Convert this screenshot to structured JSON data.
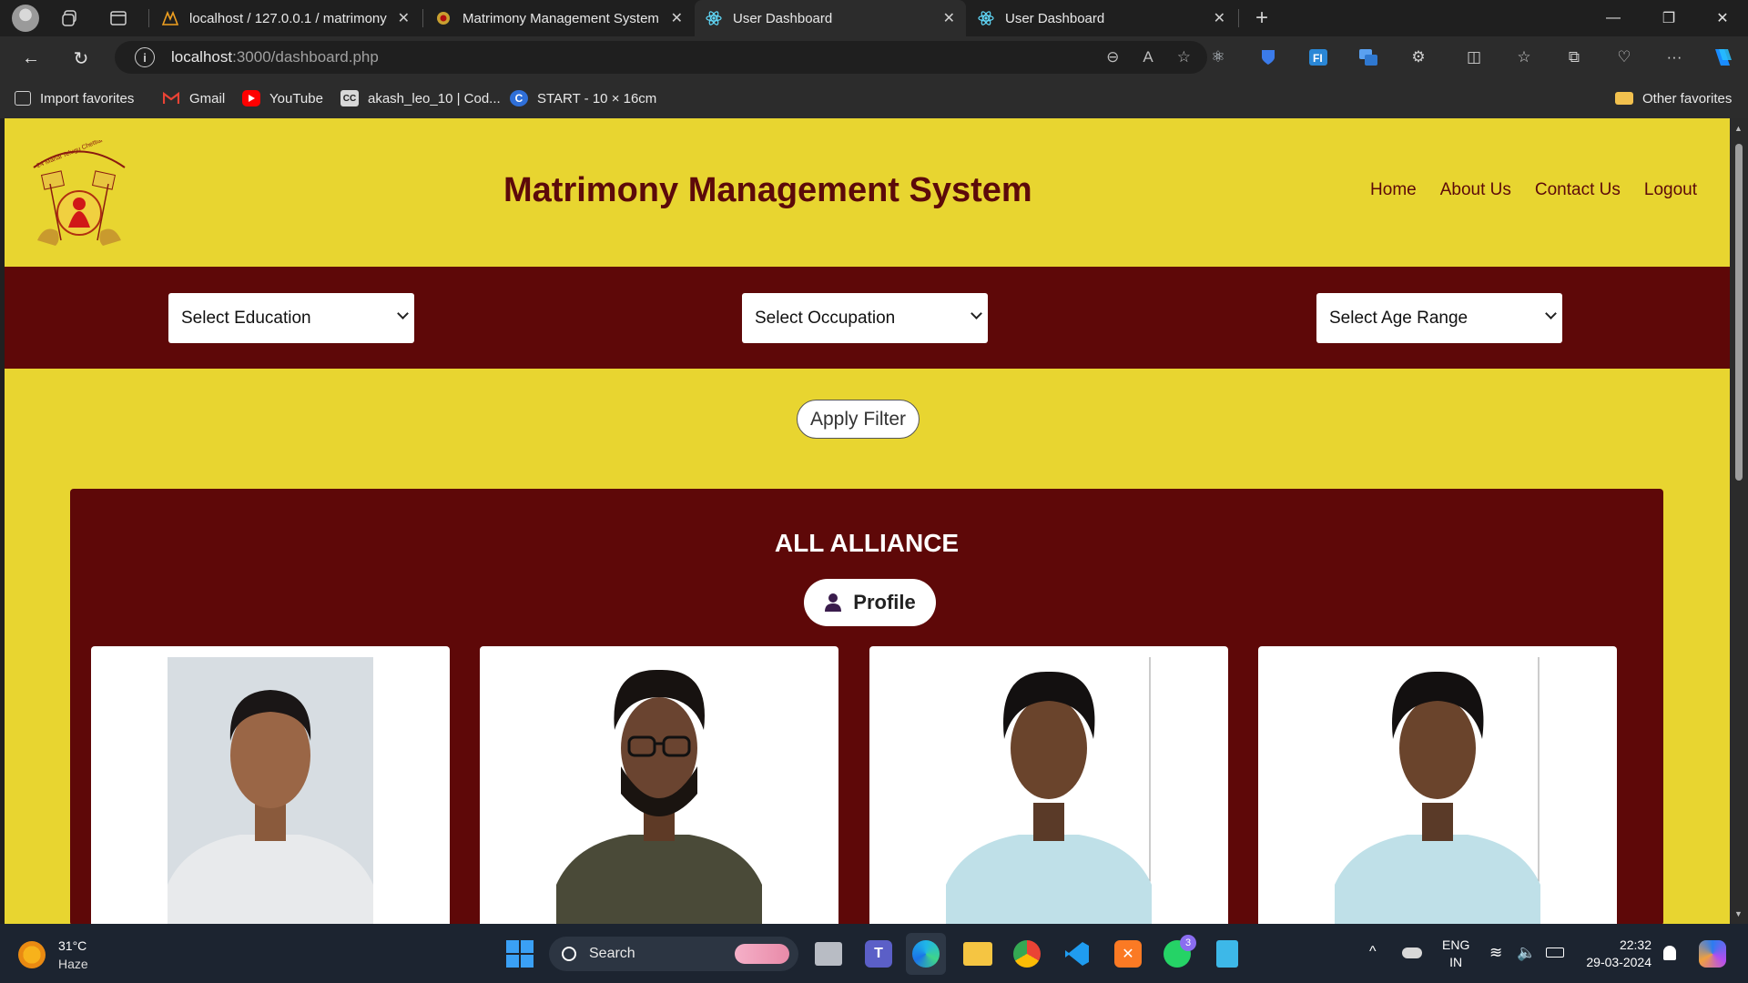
{
  "browser": {
    "tabs": [
      {
        "title": "localhost / 127.0.0.1 / matrimony",
        "icon": "phpmyadmin-icon",
        "active": false
      },
      {
        "title": "Matrimony Management System",
        "icon": "site-favicon",
        "active": false
      },
      {
        "title": "User Dashboard",
        "icon": "react-icon",
        "active": true
      },
      {
        "title": "User Dashboard",
        "icon": "react-icon",
        "active": false
      }
    ],
    "url_host": "localhost",
    "url_path": ":3000/dashboard.php",
    "favorites": [
      {
        "label": "Import favorites",
        "icon": "import-icon"
      },
      {
        "label": "Gmail",
        "icon": "gmail-icon"
      },
      {
        "label": "YouTube",
        "icon": "youtube-icon"
      },
      {
        "label": "akash_leo_10 | Cod...",
        "icon": "codechef-icon"
      },
      {
        "label": "START - 10 × 16cm",
        "icon": "canva-icon"
      }
    ],
    "other_favorites": "Other favorites"
  },
  "site": {
    "title": "Matrimony Management System",
    "nav": [
      "Home",
      "About Us",
      "Contact Us",
      "Logout"
    ],
    "filters": {
      "education": "Select Education",
      "occupation": "Select Occupation",
      "age": "Select Age Range"
    },
    "apply_label": "Apply Filter",
    "section_title": "ALL ALLIANCE",
    "profile_label": "Profile"
  },
  "colors": {
    "primary_yellow": "#e8d530",
    "maroon": "#5e0808",
    "title_maroon": "#5c0a0a"
  },
  "taskbar": {
    "temp": "31°C",
    "weather": "Haze",
    "search_placeholder": "Search",
    "lang": "ENG",
    "region": "IN",
    "time": "22:32",
    "date": "29-03-2024",
    "whatsapp_badge": "3"
  }
}
